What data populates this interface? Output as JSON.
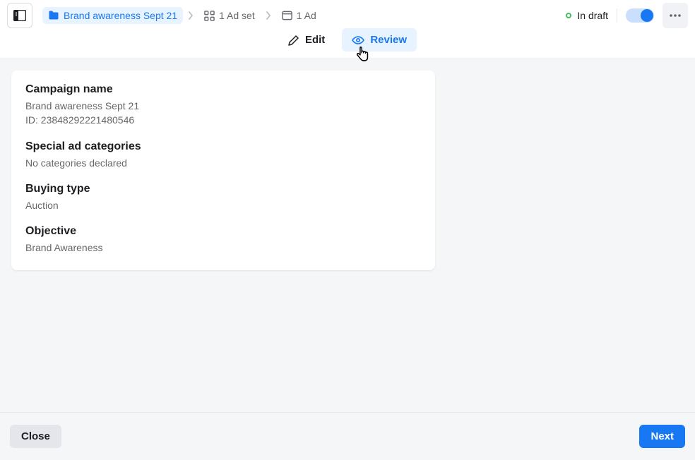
{
  "breadcrumb": {
    "campaign": "Brand awareness Sept 21",
    "adset": "1 Ad set",
    "ad": "1 Ad"
  },
  "status": {
    "label": "In draft"
  },
  "tabs": {
    "edit": "Edit",
    "review": "Review"
  },
  "review": {
    "campaign_name": {
      "title": "Campaign name",
      "value": "Brand awareness Sept 21",
      "id_line": "ID: 23848292221480546"
    },
    "special_ad_categories": {
      "title": "Special ad categories",
      "value": "No categories declared"
    },
    "buying_type": {
      "title": "Buying type",
      "value": "Auction"
    },
    "objective": {
      "title": "Objective",
      "value": "Brand Awareness"
    }
  },
  "footer": {
    "close": "Close",
    "next": "Next"
  }
}
